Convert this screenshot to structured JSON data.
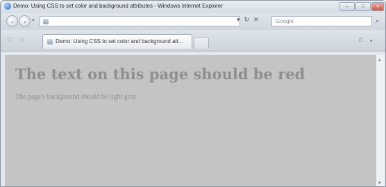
{
  "window": {
    "title": "Demo: Using CSS to set color and background attributes - Windows Internet Explorer"
  },
  "navigation": {
    "search_placeholder": "Google"
  },
  "tab": {
    "label": "Demo: Using CSS to set color and background att..."
  },
  "page": {
    "heading": "The text on this page should be red",
    "paragraph": "The page's background should be light gray"
  },
  "icons": {
    "back": "back-arrow-icon",
    "forward": "forward-arrow-icon",
    "refresh": "refresh-icon",
    "stop": "stop-icon",
    "search": "search-icon",
    "favorites": "star-icon",
    "add_favorites": "add-favorites-icon",
    "home": "home-icon"
  },
  "colors": {
    "page_background": "#c4c4c4",
    "page_text": "#8f8f8f"
  }
}
